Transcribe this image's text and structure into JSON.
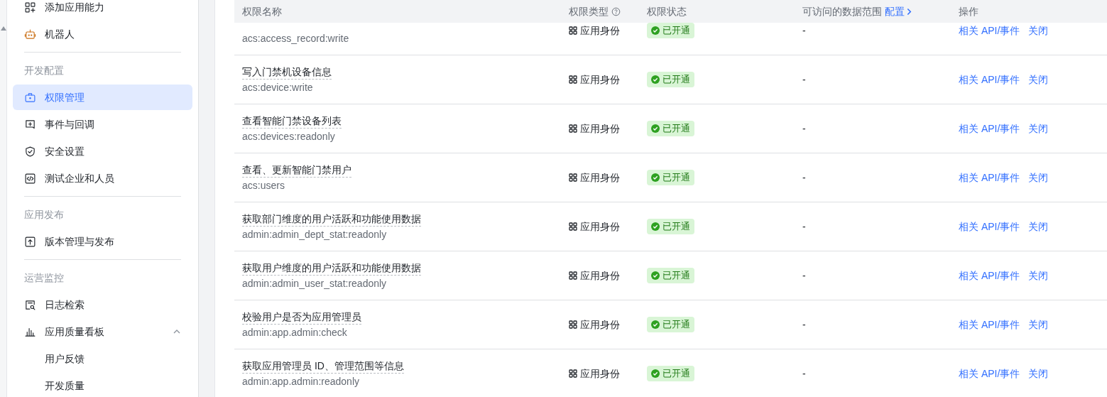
{
  "sidebar": {
    "groups": [
      {
        "items": [
          {
            "label": "添加应用能力",
            "selected": false
          },
          {
            "label": "机器人",
            "selected": false
          }
        ]
      },
      {
        "title": "开发配置",
        "items": [
          {
            "label": "权限管理",
            "selected": true
          },
          {
            "label": "事件与回调",
            "selected": false
          },
          {
            "label": "安全设置",
            "selected": false
          },
          {
            "label": "测试企业和人员",
            "selected": false
          }
        ]
      },
      {
        "title": "应用发布",
        "items": [
          {
            "label": "版本管理与发布",
            "selected": false
          }
        ]
      },
      {
        "title": "运营监控",
        "items": [
          {
            "label": "日志检索",
            "selected": false
          },
          {
            "label": "应用质量看板",
            "selected": false,
            "expanded": true,
            "children": [
              {
                "label": "用户反馈",
                "selected": false
              },
              {
                "label": "开发质量",
                "selected": false
              }
            ]
          }
        ]
      }
    ]
  },
  "table": {
    "columns": [
      "权限名称",
      "权限类型",
      "权限状态",
      "可访问的数据范围",
      "操作"
    ],
    "scope_link": "配置",
    "rows": [
      {
        "code": "acs:access_record:write",
        "type": "应用身份",
        "status": "已开通",
        "scope": "-",
        "actions": [
          "相关 API/事件",
          "关闭"
        ]
      },
      {
        "name": "写入门禁机设备信息",
        "code": "acs:device:write",
        "type": "应用身份",
        "status": "已开通",
        "scope": "-",
        "actions": [
          "相关 API/事件",
          "关闭"
        ]
      },
      {
        "name": "查看智能门禁设备列表",
        "code": "acs:devices:readonly",
        "type": "应用身份",
        "status": "已开通",
        "scope": "-",
        "actions": [
          "相关 API/事件",
          "关闭"
        ]
      },
      {
        "name": "查看、更新智能门禁用户",
        "code": "acs:users",
        "type": "应用身份",
        "status": "已开通",
        "scope": "-",
        "actions": [
          "相关 API/事件",
          "关闭"
        ]
      },
      {
        "name": "获取部门维度的用户活跃和功能使用数据",
        "code": "admin:admin_dept_stat:readonly",
        "type": "应用身份",
        "status": "已开通",
        "scope": "-",
        "actions": [
          "相关 API/事件",
          "关闭"
        ]
      },
      {
        "name": "获取用户维度的用户活跃和功能使用数据",
        "code": "admin:admin_user_stat:readonly",
        "type": "应用身份",
        "status": "已开通",
        "scope": "-",
        "actions": [
          "相关 API/事件",
          "关闭"
        ]
      },
      {
        "name": "校验用户是否为应用管理员",
        "code": "admin:app.admin:check",
        "type": "应用身份",
        "status": "已开通",
        "scope": "-",
        "actions": [
          "相关 API/事件",
          "关闭"
        ]
      },
      {
        "name": "获取应用管理员 ID、管理范围等信息",
        "code": "admin:app.admin:readonly",
        "type": "应用身份",
        "status": "已开通",
        "scope": "-",
        "actions": [
          "相关 API/事件",
          "关闭"
        ]
      }
    ]
  }
}
